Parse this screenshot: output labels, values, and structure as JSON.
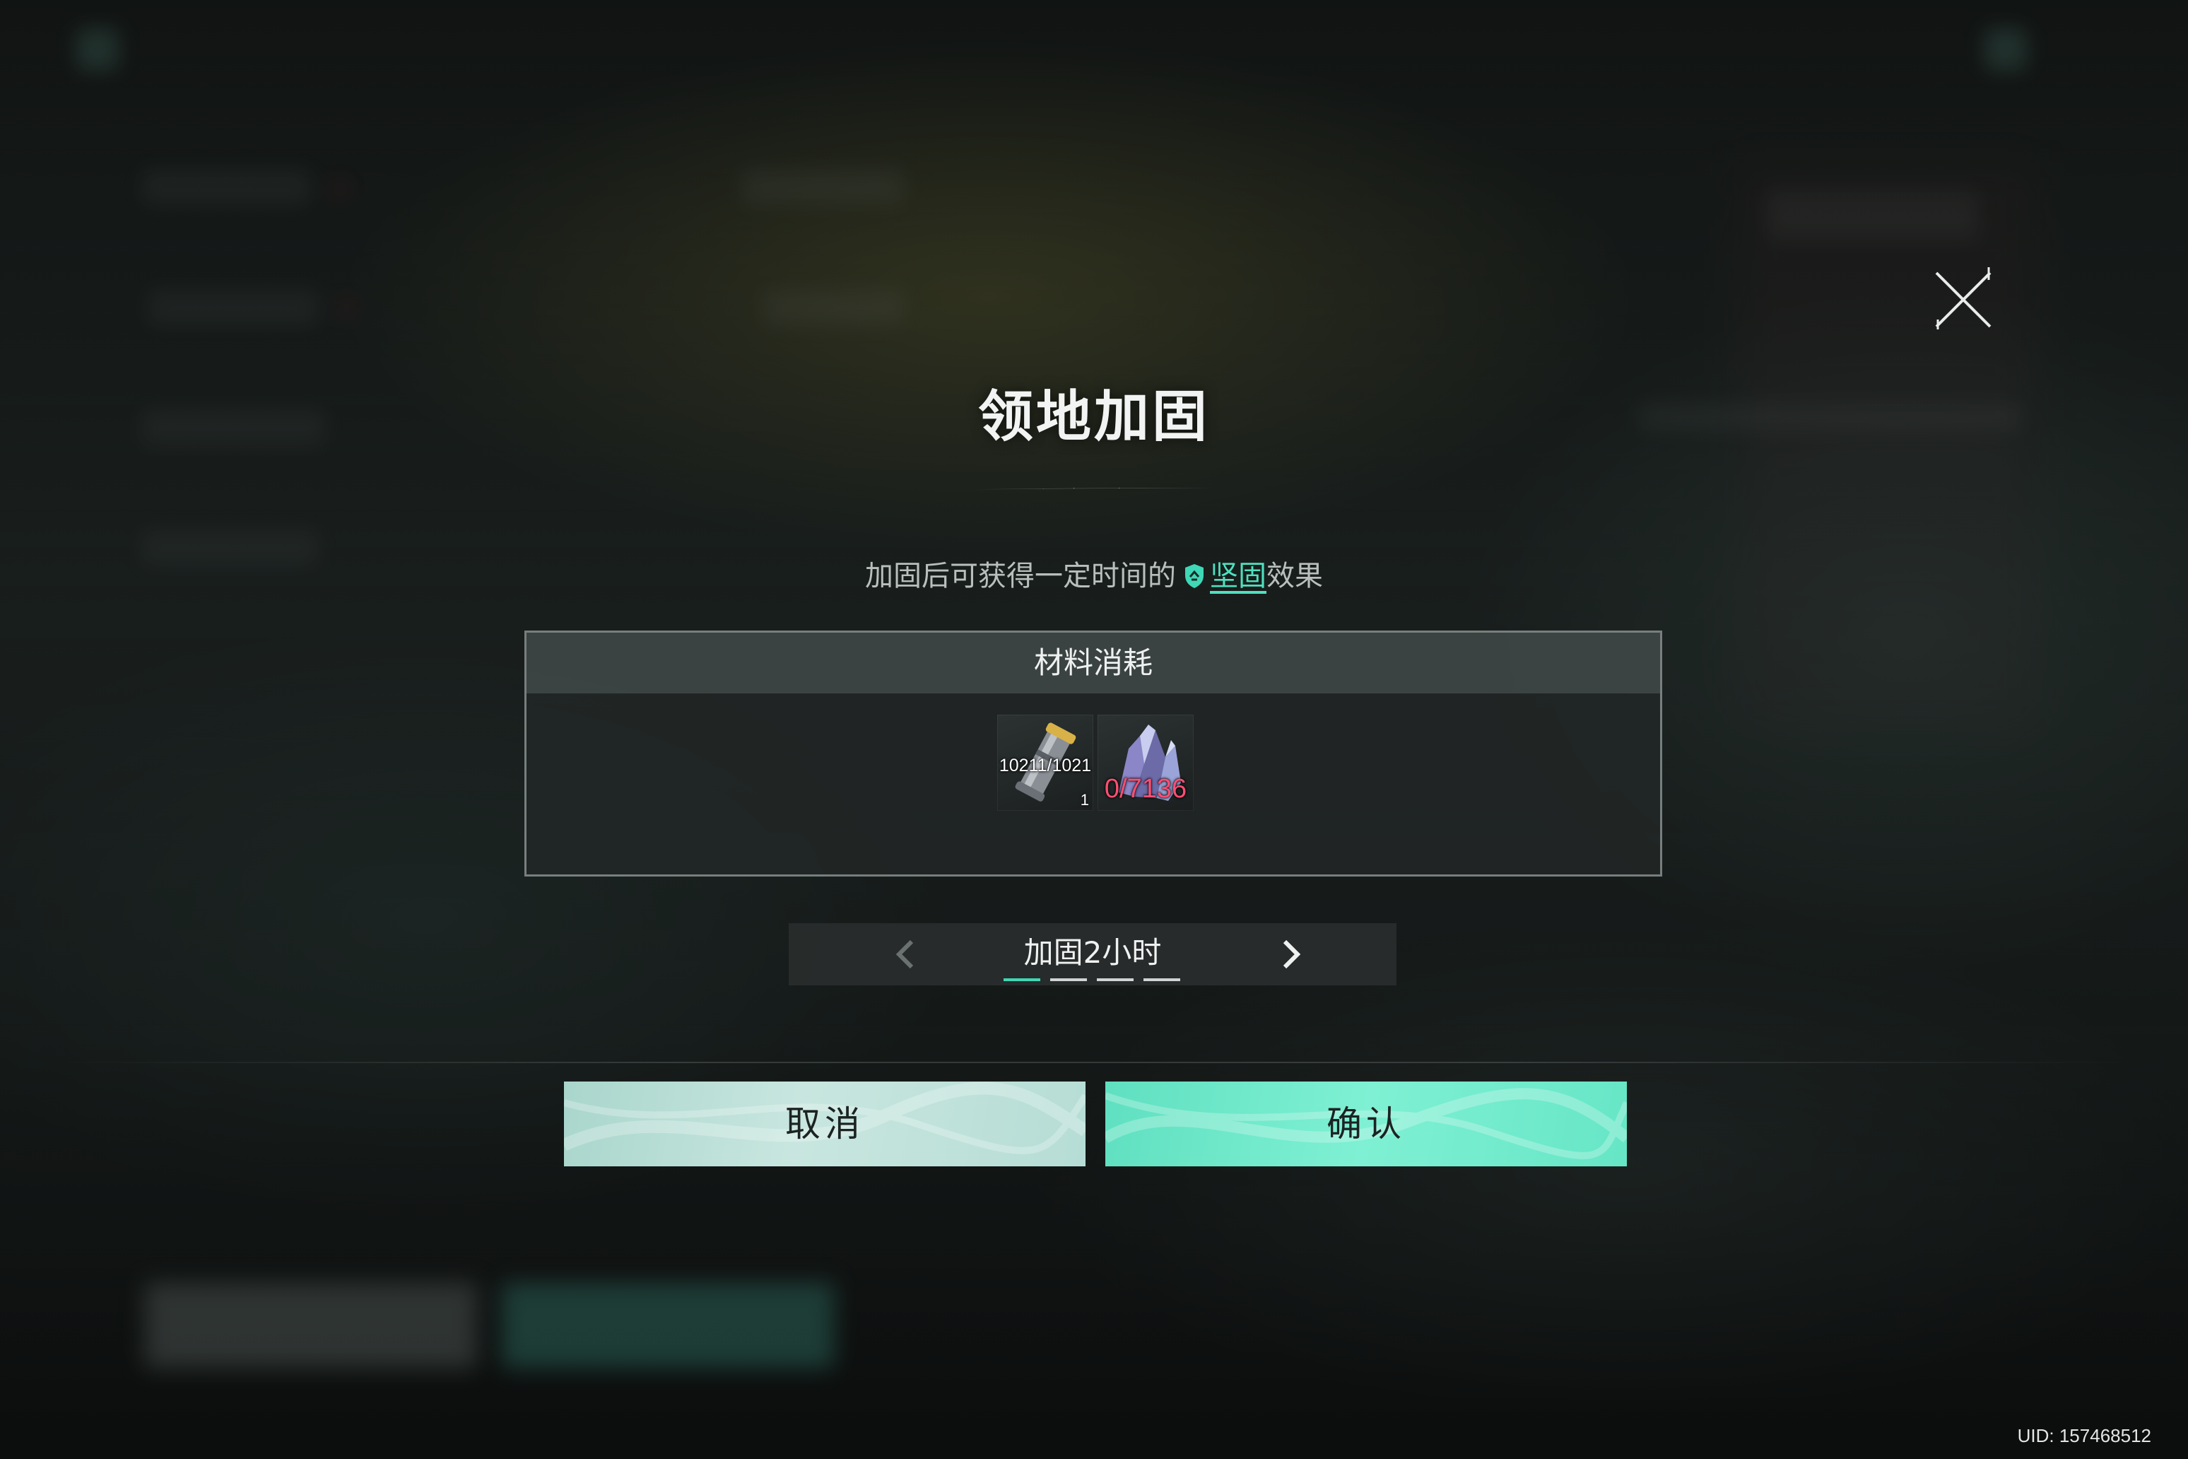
{
  "dialog": {
    "title": "领地加固",
    "subtitle_pre": "加固后可获得一定时间的",
    "subtitle_link": "坚固",
    "subtitle_post": "效果"
  },
  "materials": {
    "header": "材料消耗",
    "items": [
      {
        "icon": "metal-canister-icon",
        "count": "10211/1021",
        "sub": "1"
      },
      {
        "icon": "crystal-ore-icon",
        "count": "0/7136",
        "color": "#ff4f73"
      }
    ]
  },
  "duration": {
    "label": "加固2小时",
    "pages_total": 4,
    "page_active": 1
  },
  "buttons": {
    "cancel_label": "取消",
    "confirm_label": "确认"
  },
  "uid_text": "UID: 157468512",
  "colors": {
    "accent": "#4fe0bf",
    "confirm_bg": "#6fe8ca",
    "cancel_bg": "#b9ddd5",
    "insufficient": "#ff4f73"
  }
}
